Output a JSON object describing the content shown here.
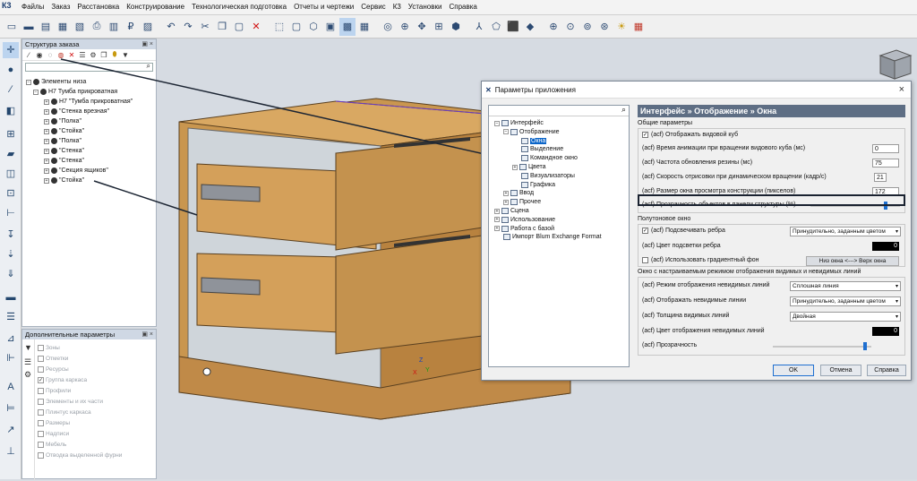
{
  "menu": {
    "logo": "К3",
    "items": [
      "Файлы",
      "Заказ",
      "Расстановка",
      "Конструирование",
      "Технологическая подготовка",
      "Отчеты и чертежи",
      "Сервис",
      "К3",
      "Установки",
      "Справка"
    ]
  },
  "order_structure": {
    "title": "Структура заказа",
    "pin": "▣ ×",
    "root": "Элементы низа",
    "cabinet": "Н7 Тумба прикроватная",
    "items": [
      "Н7 \"Тумба прикроватная\"",
      "\"Стенка врезная\"",
      "\"Полка\"",
      "\"Стойка\"",
      "\"Полка\"",
      "\"Стенка\"",
      "\"Стенка\"",
      "\"Секция ящиков\"",
      "\"Стойка\""
    ]
  },
  "extra_params": {
    "title": "Дополнительные параметры",
    "pin": "▣ ×",
    "items": [
      {
        "label": "Зоны",
        "checked": false
      },
      {
        "label": "Отметки",
        "checked": false
      },
      {
        "label": "Ресурсы",
        "checked": false
      },
      {
        "label": "Группа каркаса",
        "checked": true
      },
      {
        "label": "Профили",
        "checked": false
      },
      {
        "label": "Элементы и их части",
        "checked": false
      },
      {
        "label": "Плинтус каркаса",
        "checked": false
      },
      {
        "label": "Размеры",
        "checked": false
      },
      {
        "label": "Надписи",
        "checked": false
      },
      {
        "label": "Мебель",
        "checked": false
      },
      {
        "label": "Отводка выделенной фурни",
        "checked": false
      }
    ]
  },
  "dialog": {
    "title": "Параметры приложения",
    "close": "×",
    "tree": [
      {
        "label": "Интерфейс",
        "level": 0,
        "exp": "−"
      },
      {
        "label": "Отображение",
        "level": 1,
        "exp": "−"
      },
      {
        "label": "Окна",
        "level": 2,
        "exp": "",
        "selected": true
      },
      {
        "label": "Выделение",
        "level": 2,
        "exp": ""
      },
      {
        "label": "Командное окно",
        "level": 2,
        "exp": ""
      },
      {
        "label": "Цвета",
        "level": 2,
        "exp": "+"
      },
      {
        "label": "Визуализаторы",
        "level": 2,
        "exp": ""
      },
      {
        "label": "Графика",
        "level": 2,
        "exp": ""
      },
      {
        "label": "Ввод",
        "level": 1,
        "exp": "+"
      },
      {
        "label": "Прочее",
        "level": 1,
        "exp": "+"
      },
      {
        "label": "Сцена",
        "level": 0,
        "exp": "+"
      },
      {
        "label": "Использование",
        "level": 0,
        "exp": "+"
      },
      {
        "label": "Работа с базой",
        "level": 0,
        "exp": "+"
      },
      {
        "label": "Импорт Blum Exchange Format",
        "level": 0,
        "exp": ""
      }
    ],
    "header": "Интерфейс » Отображение » Окна",
    "general": {
      "legend": "Общие параметры",
      "show_cube": "(acf) Отображать видовой куб",
      "anim_time": "(acf) Время анимации при вращении видового куба (мс)",
      "anim_time_val": "0",
      "rubber_freq": "(acf) Частота обновления резины (мс)",
      "rubber_freq_val": "75",
      "draw_speed": "(acf) Скорость отрисовки при динамическом вращении (кадр/с)",
      "draw_speed_val": "21",
      "preview_size": "(acf) Размер окна просмотра конструкции (пикселов)",
      "preview_size_val": "172",
      "transparency": "(acf) Прозрачность объектов в панели структуры (%)",
      "transparency_level": 0.85
    },
    "halftone": {
      "legend": "Полутоновое окно",
      "highlight_edges": "(acf) Подсвечивать ребра",
      "highlight_edges_val": "Принудительно, заданным цветом",
      "edge_color": "(acf) Цвет подсветки ребра",
      "edge_color_val": "0",
      "gradient": "(acf) Использовать градиентный фон",
      "gradient_btn": "Низ окна <---> Верх окна"
    },
    "hidden_lines": {
      "legend": "Окно с настраиваемым режимом отображения видимых и невидимых линий",
      "invisible_mode": "(acf) Режим отображения невидимых линий",
      "invisible_mode_val": "Сплошная линия",
      "show_invisible": "(acf) Отображать невидимые линии",
      "show_invisible_val": "Принудительно, заданным цветом",
      "visible_thickness": "(acf) Толщина видимых линий",
      "visible_thickness_val": "Двойная",
      "invisible_color": "(acf) Цвет отображения невидимых линий",
      "invisible_color_val": "0",
      "transparency": "(acf) Прозрачность",
      "transparency_level": 0.95
    },
    "buttons": {
      "ok": "OK",
      "cancel": "Отмена",
      "help": "Справка"
    }
  },
  "axes": {
    "x": "X",
    "y": "Y",
    "z": "Z"
  }
}
